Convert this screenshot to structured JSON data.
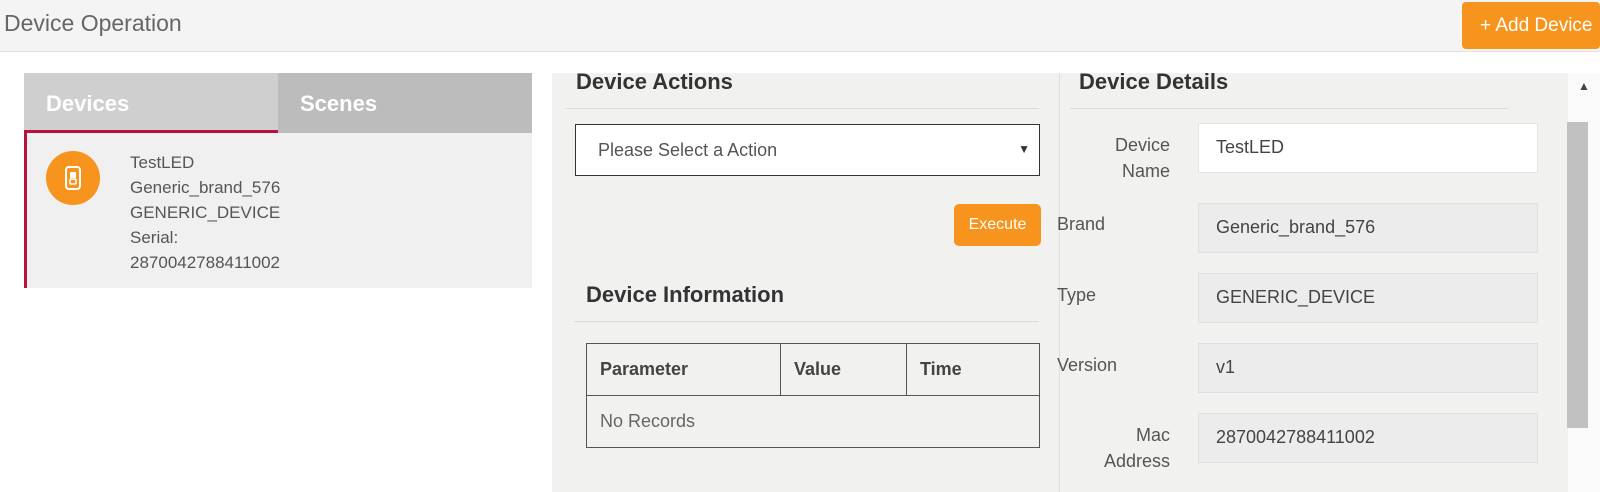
{
  "header": {
    "title": "Device Operation",
    "add_device_label": "+ Add Device"
  },
  "tabs": [
    {
      "label": "Devices",
      "active": true
    },
    {
      "label": "Scenes",
      "active": false
    }
  ],
  "device_card": {
    "icon": "device-switch-icon",
    "name": "TestLED",
    "brand": "Generic_brand_576",
    "type": "GENERIC_DEVICE",
    "serial_label": "Serial:",
    "serial": "2870042788411002"
  },
  "actions": {
    "title": "Device Actions",
    "select_value": "Please Select a Action",
    "execute_label": "Execute"
  },
  "info": {
    "title": "Device Information",
    "columns": [
      "Parameter",
      "Value",
      "Time"
    ],
    "empty_text": "No Records"
  },
  "details": {
    "title": "Device Details",
    "fields": [
      {
        "label": "Device Name",
        "value": "TestLED"
      },
      {
        "label": "Brand",
        "value": "Generic_brand_576"
      },
      {
        "label": "Type",
        "value": "GENERIC_DEVICE"
      },
      {
        "label": "Version",
        "value": "v1"
      },
      {
        "label": "Mac Address",
        "value": "2870042788411002"
      }
    ]
  },
  "colors": {
    "accent": "#f7941d",
    "active_tab_border": "#b9123a"
  }
}
